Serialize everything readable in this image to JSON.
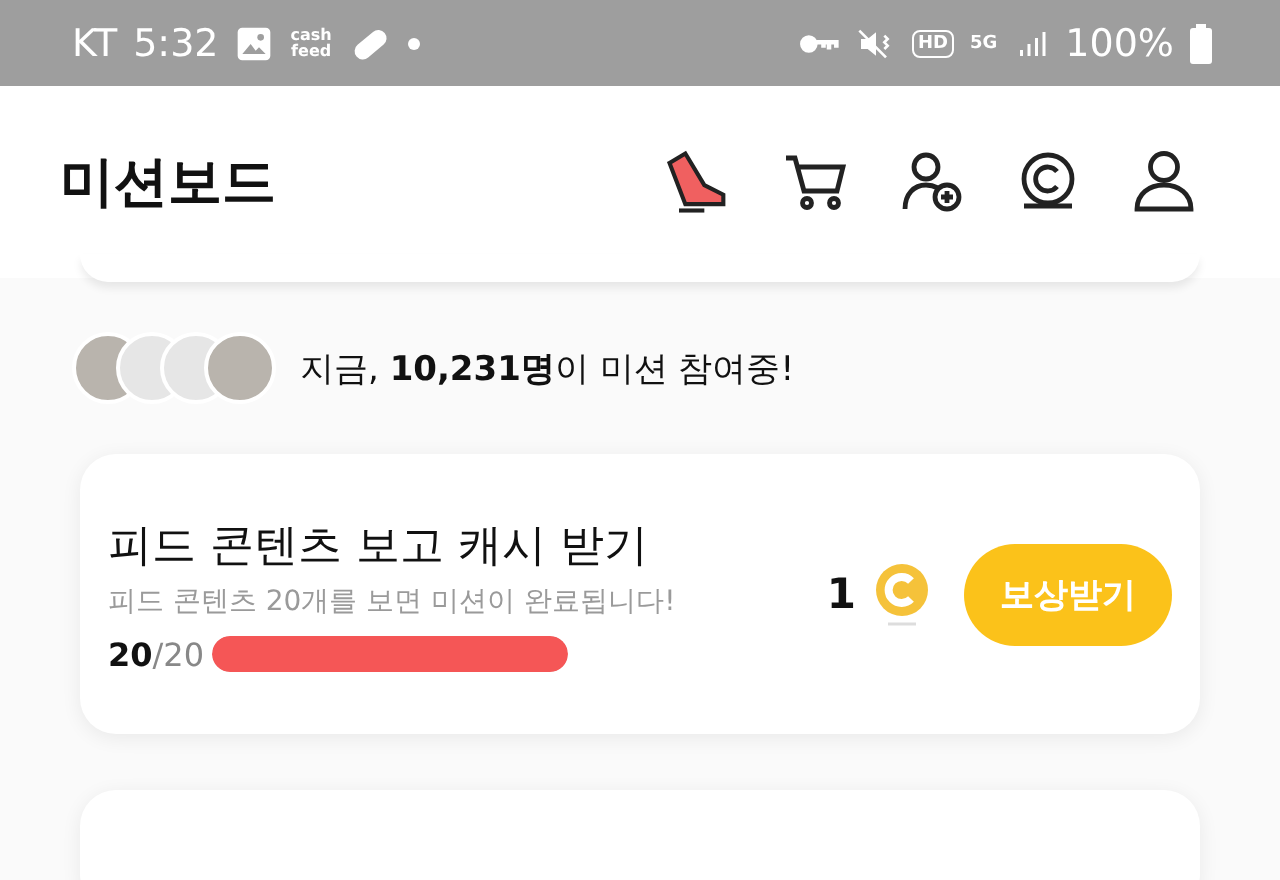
{
  "status_bar": {
    "carrier": "KT",
    "time": "5:32",
    "app_badge": [
      "cash",
      "feed"
    ],
    "network_badge": "HD",
    "network_type": "5G",
    "battery": "100%"
  },
  "header": {
    "title": "미션보드"
  },
  "participants": {
    "avatars": [
      {
        "kind": "photo"
      },
      {
        "kind": "generic"
      },
      {
        "kind": "generic"
      },
      {
        "kind": "photo"
      }
    ],
    "text": "지금, **10,231명**이 미션 참여중!"
  },
  "missions": [
    {
      "title": "피드 콘텐츠 보고 캐시 받기",
      "description": "피드 콘텐츠 20개를 보면 미션이 완료됩니다!",
      "done": "20",
      "total": "/20",
      "level": 1,
      "reward": "1",
      "button": "보상받기"
    }
  ]
}
